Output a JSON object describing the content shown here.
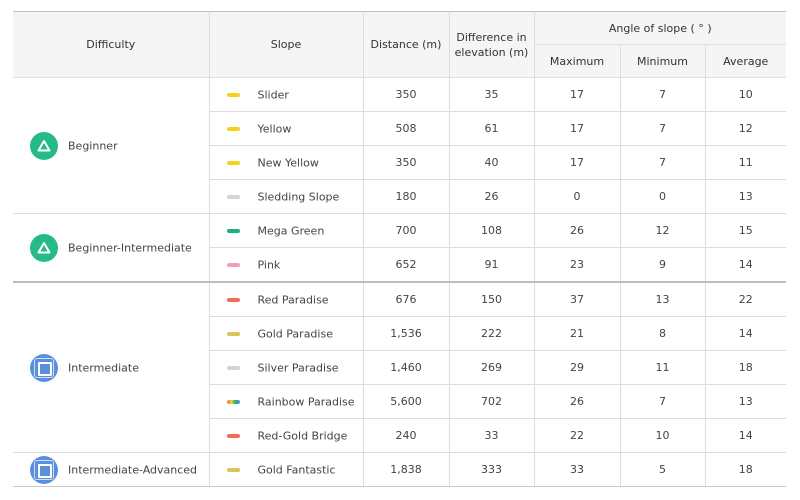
{
  "header": {
    "difficulty": "Difficulty",
    "slope": "Slope",
    "distance": "Distance (m)",
    "elevation": "Difference in elevation (m)",
    "angle_group": "Angle of slope ( ° )",
    "maximum": "Maximum",
    "minimum": "Minimum",
    "average": "Average"
  },
  "groups": [
    {
      "label": "Beginner",
      "icon": "triangle-icon",
      "color": "#26b98a"
    },
    {
      "label": "Beginner-Intermediate",
      "icon": "triangle-icon",
      "color": "#26b98a"
    },
    {
      "label": "Intermediate",
      "icon": "square-icon",
      "color": "#5a8fde"
    },
    {
      "label": "Intermediate-Advanced",
      "icon": "square-icon",
      "color": "#5a8fde"
    }
  ],
  "rows": [
    {
      "name": "Slider",
      "color": "#f5d21f",
      "distance": "350",
      "elevation": "35",
      "max": "17",
      "min": "7",
      "avg": "10"
    },
    {
      "name": "Yellow",
      "color": "#f5d21f",
      "distance": "508",
      "elevation": "61",
      "max": "17",
      "min": "7",
      "avg": "12"
    },
    {
      "name": "New Yellow",
      "color": "#f5d21f",
      "distance": "350",
      "elevation": "40",
      "max": "17",
      "min": "7",
      "avg": "11"
    },
    {
      "name": "Sledding Slope",
      "color": "#cfd6de",
      "distance": "180",
      "elevation": "26",
      "max": "0",
      "min": "0",
      "avg": "13"
    },
    {
      "name": "Mega Green",
      "color": "#1bb07a",
      "distance": "700",
      "elevation": "108",
      "max": "26",
      "min": "12",
      "avg": "15"
    },
    {
      "name": "Pink",
      "color": "#f59ac0",
      "distance": "652",
      "elevation": "91",
      "max": "23",
      "min": "9",
      "avg": "14"
    },
    {
      "name": "Red Paradise",
      "color": "#f06a5e",
      "distance": "676",
      "elevation": "150",
      "max": "37",
      "min": "13",
      "avg": "22"
    },
    {
      "name": "Gold Paradise",
      "color": "#dcc35a",
      "distance": "1,536",
      "elevation": "222",
      "max": "21",
      "min": "8",
      "avg": "14"
    },
    {
      "name": "Silver Paradise",
      "color": "#cfd6de",
      "distance": "1,460",
      "elevation": "269",
      "max": "29",
      "min": "11",
      "avg": "18"
    },
    {
      "name": "Rainbow Paradise",
      "color": "rainbow",
      "distance": "5,600",
      "elevation": "702",
      "max": "26",
      "min": "7",
      "avg": "13"
    },
    {
      "name": "Red-Gold Bridge",
      "color": "#f06a5e",
      "distance": "240",
      "elevation": "33",
      "max": "22",
      "min": "10",
      "avg": "14"
    },
    {
      "name": "Gold Fantastic",
      "color": "#dcc35a",
      "distance": "1,838",
      "elevation": "333",
      "max": "33",
      "min": "5",
      "avg": "18"
    }
  ]
}
